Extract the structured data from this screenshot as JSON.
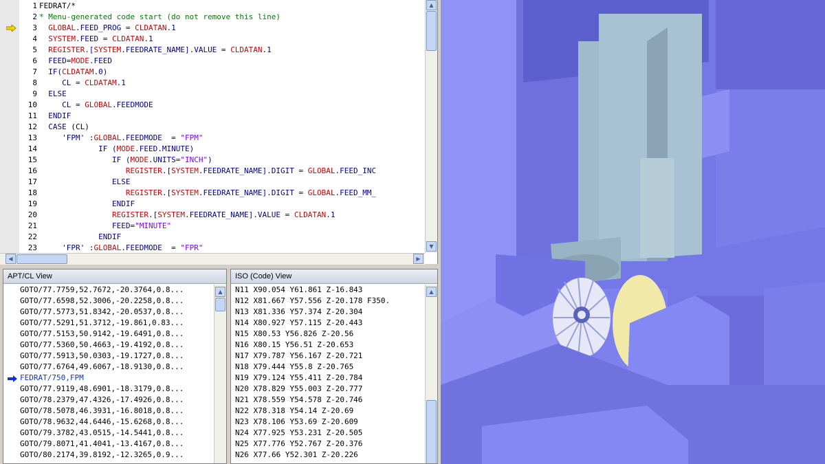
{
  "editor": {
    "lines": [
      {
        "num": "1",
        "indent": 0,
        "tokens": [
          {
            "t": "FEDRAT/*",
            "c": "black"
          }
        ]
      },
      {
        "num": "2",
        "indent": 0,
        "tokens": [
          {
            "t": "* Menu-generated code start (do not remove this line)",
            "c": "green"
          }
        ]
      },
      {
        "num": "3",
        "indent": 2,
        "marker": "arrow",
        "tokens": [
          {
            "t": "GLOBAL",
            "c": "red"
          },
          {
            "t": ".FEED_PROG = ",
            "c": "blue"
          },
          {
            "t": "CLDATAN",
            "c": "red"
          },
          {
            "t": ".1",
            "c": "blue"
          }
        ]
      },
      {
        "num": "4",
        "indent": 2,
        "tokens": [
          {
            "t": "SYSTEM",
            "c": "red"
          },
          {
            "t": ".FEED = ",
            "c": "blue"
          },
          {
            "t": "CLDATAN",
            "c": "red"
          },
          {
            "t": ".1",
            "c": "blue"
          }
        ]
      },
      {
        "num": "5",
        "indent": 2,
        "tokens": [
          {
            "t": "REGISTER",
            "c": "red"
          },
          {
            "t": ".[",
            "c": "blue"
          },
          {
            "t": "SYSTEM",
            "c": "red"
          },
          {
            "t": ".FEEDRATE_NAME].VALUE = ",
            "c": "blue"
          },
          {
            "t": "CLDATAN",
            "c": "red"
          },
          {
            "t": ".1",
            "c": "blue"
          }
        ]
      },
      {
        "num": "6",
        "indent": 2,
        "tokens": [
          {
            "t": "FEED=",
            "c": "blue"
          },
          {
            "t": "MODE",
            "c": "red"
          },
          {
            "t": ".FEED",
            "c": "blue"
          }
        ]
      },
      {
        "num": "7",
        "indent": 2,
        "tokens": [
          {
            "t": "IF(",
            "c": "blue"
          },
          {
            "t": "CLDATAM",
            "c": "red"
          },
          {
            "t": ".0)",
            "c": "blue"
          }
        ]
      },
      {
        "num": "8",
        "indent": 5,
        "tokens": [
          {
            "t": "CL = ",
            "c": "blue"
          },
          {
            "t": "CLDATAM",
            "c": "red"
          },
          {
            "t": ".1",
            "c": "blue"
          }
        ]
      },
      {
        "num": "9",
        "indent": 2,
        "tokens": [
          {
            "t": "ELSE",
            "c": "blue"
          }
        ]
      },
      {
        "num": "10",
        "indent": 5,
        "tokens": [
          {
            "t": "CL = ",
            "c": "blue"
          },
          {
            "t": "GLOBAL",
            "c": "red"
          },
          {
            "t": ".FEEDMODE",
            "c": "blue"
          }
        ]
      },
      {
        "num": "11",
        "indent": 2,
        "tokens": [
          {
            "t": "ENDIF",
            "c": "blue"
          }
        ]
      },
      {
        "num": "12",
        "indent": 2,
        "tokens": [
          {
            "t": "CASE ",
            "c": "blue"
          },
          {
            "t": "(CL)",
            "c": "black"
          }
        ]
      },
      {
        "num": "13",
        "indent": 5,
        "tokens": [
          {
            "t": "'FPM' :",
            "c": "blue"
          },
          {
            "t": "GLOBAL",
            "c": "red"
          },
          {
            "t": ".FEEDMODE  = ",
            "c": "blue"
          },
          {
            "t": "\"FPM\"",
            "c": "purple"
          }
        ]
      },
      {
        "num": "14",
        "indent": 13,
        "tokens": [
          {
            "t": "IF (",
            "c": "blue"
          },
          {
            "t": "MODE",
            "c": "red"
          },
          {
            "t": ".FEED.MINUTE)",
            "c": "blue"
          }
        ]
      },
      {
        "num": "15",
        "indent": 16,
        "tokens": [
          {
            "t": "IF (",
            "c": "blue"
          },
          {
            "t": "MODE",
            "c": "red"
          },
          {
            "t": ".UNITS=",
            "c": "blue"
          },
          {
            "t": "\"INCH\"",
            "c": "purple"
          },
          {
            "t": ")",
            "c": "blue"
          }
        ]
      },
      {
        "num": "16",
        "indent": 19,
        "tokens": [
          {
            "t": "REGISTER",
            "c": "red"
          },
          {
            "t": ".[",
            "c": "blue"
          },
          {
            "t": "SYSTEM",
            "c": "red"
          },
          {
            "t": ".FEEDRATE_NAME].DIGIT = ",
            "c": "blue"
          },
          {
            "t": "GLOBAL",
            "c": "red"
          },
          {
            "t": ".FEED_INC",
            "c": "blue"
          }
        ]
      },
      {
        "num": "17",
        "indent": 16,
        "tokens": [
          {
            "t": "ELSE",
            "c": "blue"
          }
        ]
      },
      {
        "num": "18",
        "indent": 19,
        "tokens": [
          {
            "t": "REGISTER",
            "c": "red"
          },
          {
            "t": ".[",
            "c": "blue"
          },
          {
            "t": "SYSTEM",
            "c": "red"
          },
          {
            "t": ".FEEDRATE_NAME].DIGIT = ",
            "c": "blue"
          },
          {
            "t": "GLOBAL",
            "c": "red"
          },
          {
            "t": ".FEED_MM_",
            "c": "blue"
          }
        ]
      },
      {
        "num": "19",
        "indent": 16,
        "tokens": [
          {
            "t": "ENDIF",
            "c": "blue"
          }
        ]
      },
      {
        "num": "20",
        "indent": 16,
        "tokens": [
          {
            "t": "REGISTER",
            "c": "red"
          },
          {
            "t": ".[",
            "c": "blue"
          },
          {
            "t": "SYSTEM",
            "c": "red"
          },
          {
            "t": ".FEEDRATE_NAME].VALUE = ",
            "c": "blue"
          },
          {
            "t": "CLDATAN",
            "c": "red"
          },
          {
            "t": ".1",
            "c": "blue"
          }
        ]
      },
      {
        "num": "21",
        "indent": 16,
        "tokens": [
          {
            "t": "FEED=",
            "c": "blue"
          },
          {
            "t": "\"MINUTE\"",
            "c": "purple"
          }
        ]
      },
      {
        "num": "22",
        "indent": 13,
        "tokens": [
          {
            "t": "ENDIF",
            "c": "blue"
          }
        ]
      },
      {
        "num": "23",
        "indent": 5,
        "tokens": [
          {
            "t": "'FPR' :",
            "c": "blue"
          },
          {
            "t": "GLOBAL",
            "c": "red"
          },
          {
            "t": ".FEEDMODE  = ",
            "c": "blue"
          },
          {
            "t": "\"FPR\"",
            "c": "purple"
          }
        ]
      }
    ]
  },
  "apt_view": {
    "title": "APT/CL View",
    "rows": [
      {
        "text": "GOTO/77.7759,52.7672,-20.3764,0.8..."
      },
      {
        "text": "GOTO/77.6598,52.3006,-20.2258,0.8..."
      },
      {
        "text": "GOTO/77.5773,51.8342,-20.0537,0.8..."
      },
      {
        "text": "GOTO/77.5291,51.3712,-19.861,0.83..."
      },
      {
        "text": "GOTO/77.5153,50.9142,-19.6491,0.8..."
      },
      {
        "text": "GOTO/77.5360,50.4663,-19.4192,0.8..."
      },
      {
        "text": "GOTO/77.5913,50.0303,-19.1727,0.8..."
      },
      {
        "text": "GOTO/77.6764,49.6067,-18.9130,0.8..."
      },
      {
        "text": "FEDRAT/750,FPM",
        "current": true
      },
      {
        "text": "GOTO/77.9119,48.6901,-18.3179,0.8..."
      },
      {
        "text": "GOTO/78.2379,47.4326,-17.4926,0.8..."
      },
      {
        "text": "GOTO/78.5078,46.3931,-16.8018,0.8..."
      },
      {
        "text": "GOTO/78.9632,44.6446,-15.6268,0.8..."
      },
      {
        "text": "GOTO/79.3782,43.0515,-14.5441,0.8..."
      },
      {
        "text": "GOTO/79.8071,41.4041,-13.4167,0.8..."
      },
      {
        "text": "GOTO/80.2174,39.8192,-12.3265,0.9..."
      }
    ]
  },
  "iso_view": {
    "title": "ISO (Code) View",
    "rows": [
      "N11 X90.054 Y61.861 Z-16.843",
      "N12 X81.667 Y57.556 Z-20.178 F350.",
      "N13 X81.336 Y57.374 Z-20.304",
      "N14 X80.927 Y57.115 Z-20.443",
      "N15 X80.53 Y56.826 Z-20.56",
      "N16 X80.15 Y56.51 Z-20.653",
      "N17 X79.787 Y56.167 Z-20.721",
      "N18 X79.444 Y55.8 Z-20.765",
      "N19 X79.124 Y55.411 Z-20.784",
      "N20 X78.829 Y55.003 Z-20.777",
      "N21 X78.559 Y54.578 Z-20.746",
      "N22 X78.318 Y54.14 Z-20.69",
      "N23 X78.106 Y53.69 Z-20.609",
      "N24 X77.925 Y53.231 Z-20.505",
      "N25 X77.776 Y52.767 Z-20.376",
      "N26 X77.66 Y52.301 Z-20.226"
    ]
  },
  "icons": {
    "scroll_up": "▲",
    "scroll_down": "▼",
    "scroll_left": "◀",
    "scroll_right": "▶"
  },
  "colors": {
    "machine_blue": "#8a8ef5",
    "spindle_gray": "#a9c1cf",
    "part_yellow": "#f1e9a8"
  }
}
